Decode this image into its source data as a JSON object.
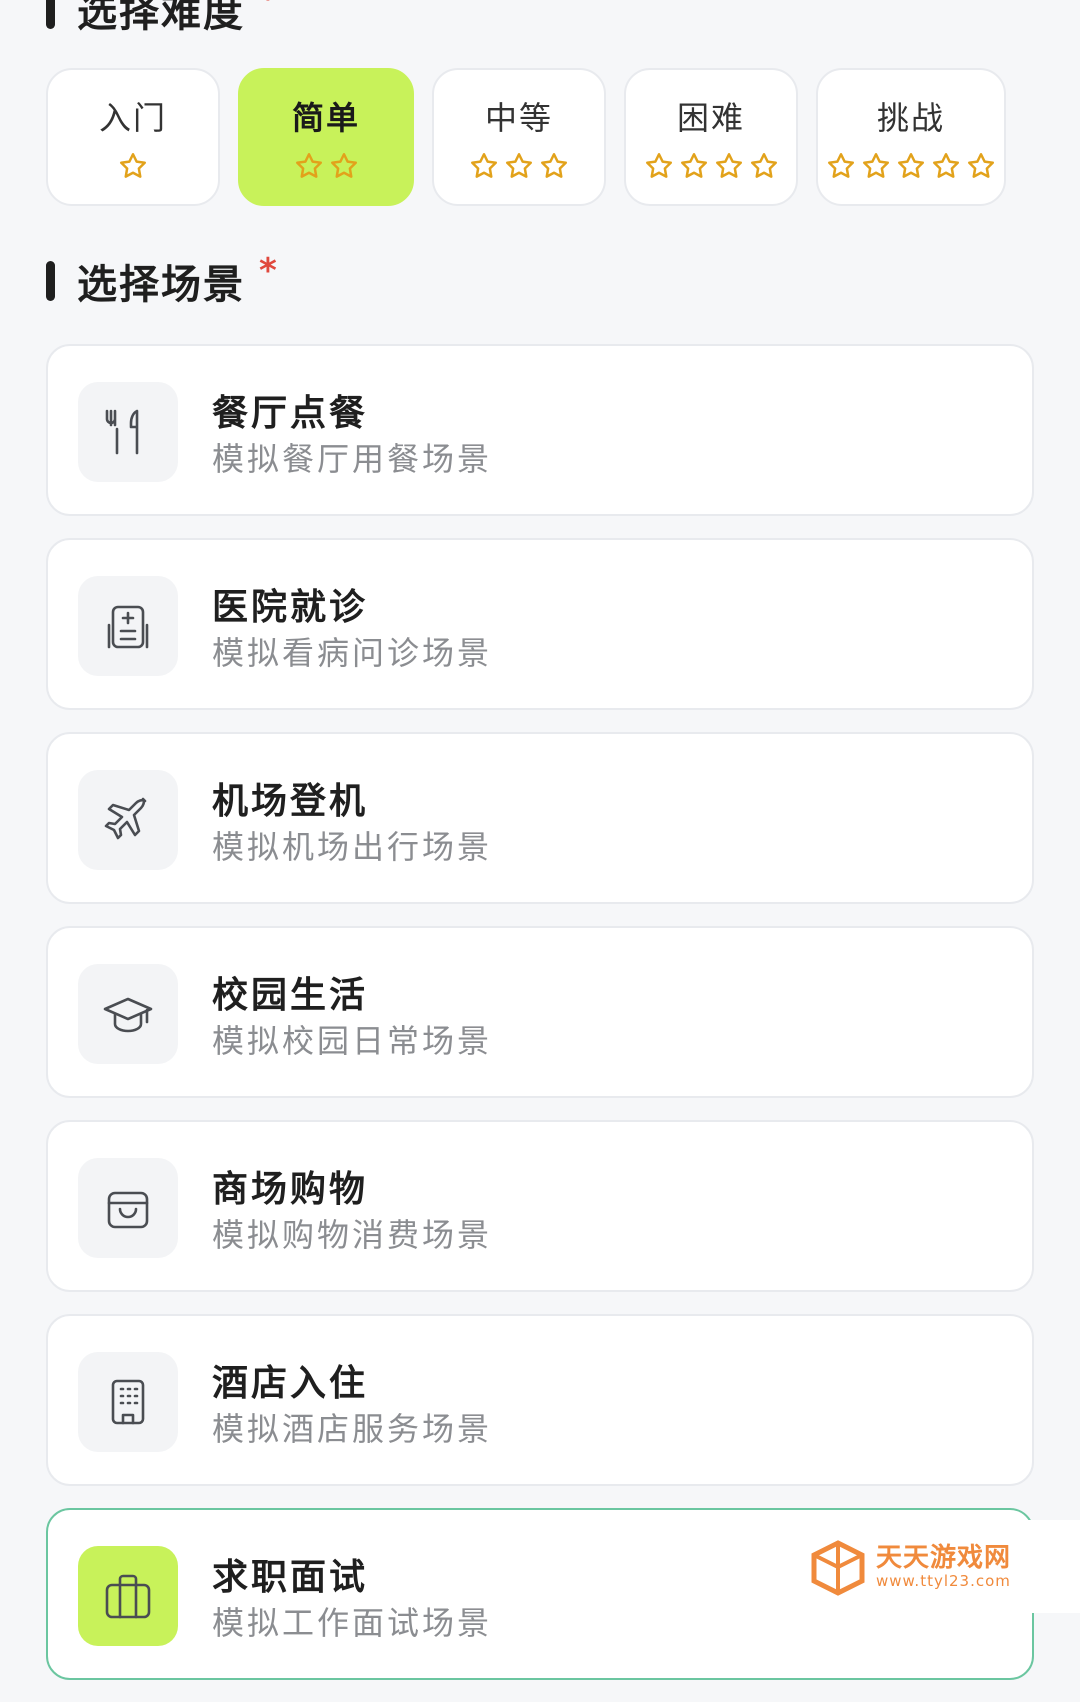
{
  "difficulty_section": {
    "title": "选择难度",
    "required_mark": "*"
  },
  "difficulty_options": [
    {
      "label": "入门",
      "stars": 1,
      "selected": false
    },
    {
      "label": "简单",
      "stars": 2,
      "selected": true
    },
    {
      "label": "中等",
      "stars": 3,
      "selected": false
    },
    {
      "label": "困难",
      "stars": 4,
      "selected": false
    },
    {
      "label": "挑战",
      "stars": 5,
      "selected": false
    }
  ],
  "scene_section": {
    "title": "选择场景",
    "required_mark": "*"
  },
  "scenes": [
    {
      "icon": "utensils-icon",
      "title": "餐厅点餐",
      "subtitle": "模拟餐厅用餐场景",
      "selected": false
    },
    {
      "icon": "hospital-icon",
      "title": "医院就诊",
      "subtitle": "模拟看病问诊场景",
      "selected": false
    },
    {
      "icon": "airplane-icon",
      "title": "机场登机",
      "subtitle": "模拟机场出行场景",
      "selected": false
    },
    {
      "icon": "graduation-cap-icon",
      "title": "校园生活",
      "subtitle": "模拟校园日常场景",
      "selected": false
    },
    {
      "icon": "shopping-bag-icon",
      "title": "商场购物",
      "subtitle": "模拟购物消费场景",
      "selected": false
    },
    {
      "icon": "building-icon",
      "title": "酒店入住",
      "subtitle": "模拟酒店服务场景",
      "selected": false
    },
    {
      "icon": "briefcase-icon",
      "title": "求职面试",
      "subtitle": "模拟工作面试场景",
      "selected": true
    }
  ],
  "watermark": {
    "name": "天天游戏网",
    "url": "www.ttyl23.com"
  },
  "colors": {
    "accent": "#c8f25a",
    "star": "#e2a21b",
    "required": "#e0483d",
    "selected_border": "#6bc6a0"
  }
}
